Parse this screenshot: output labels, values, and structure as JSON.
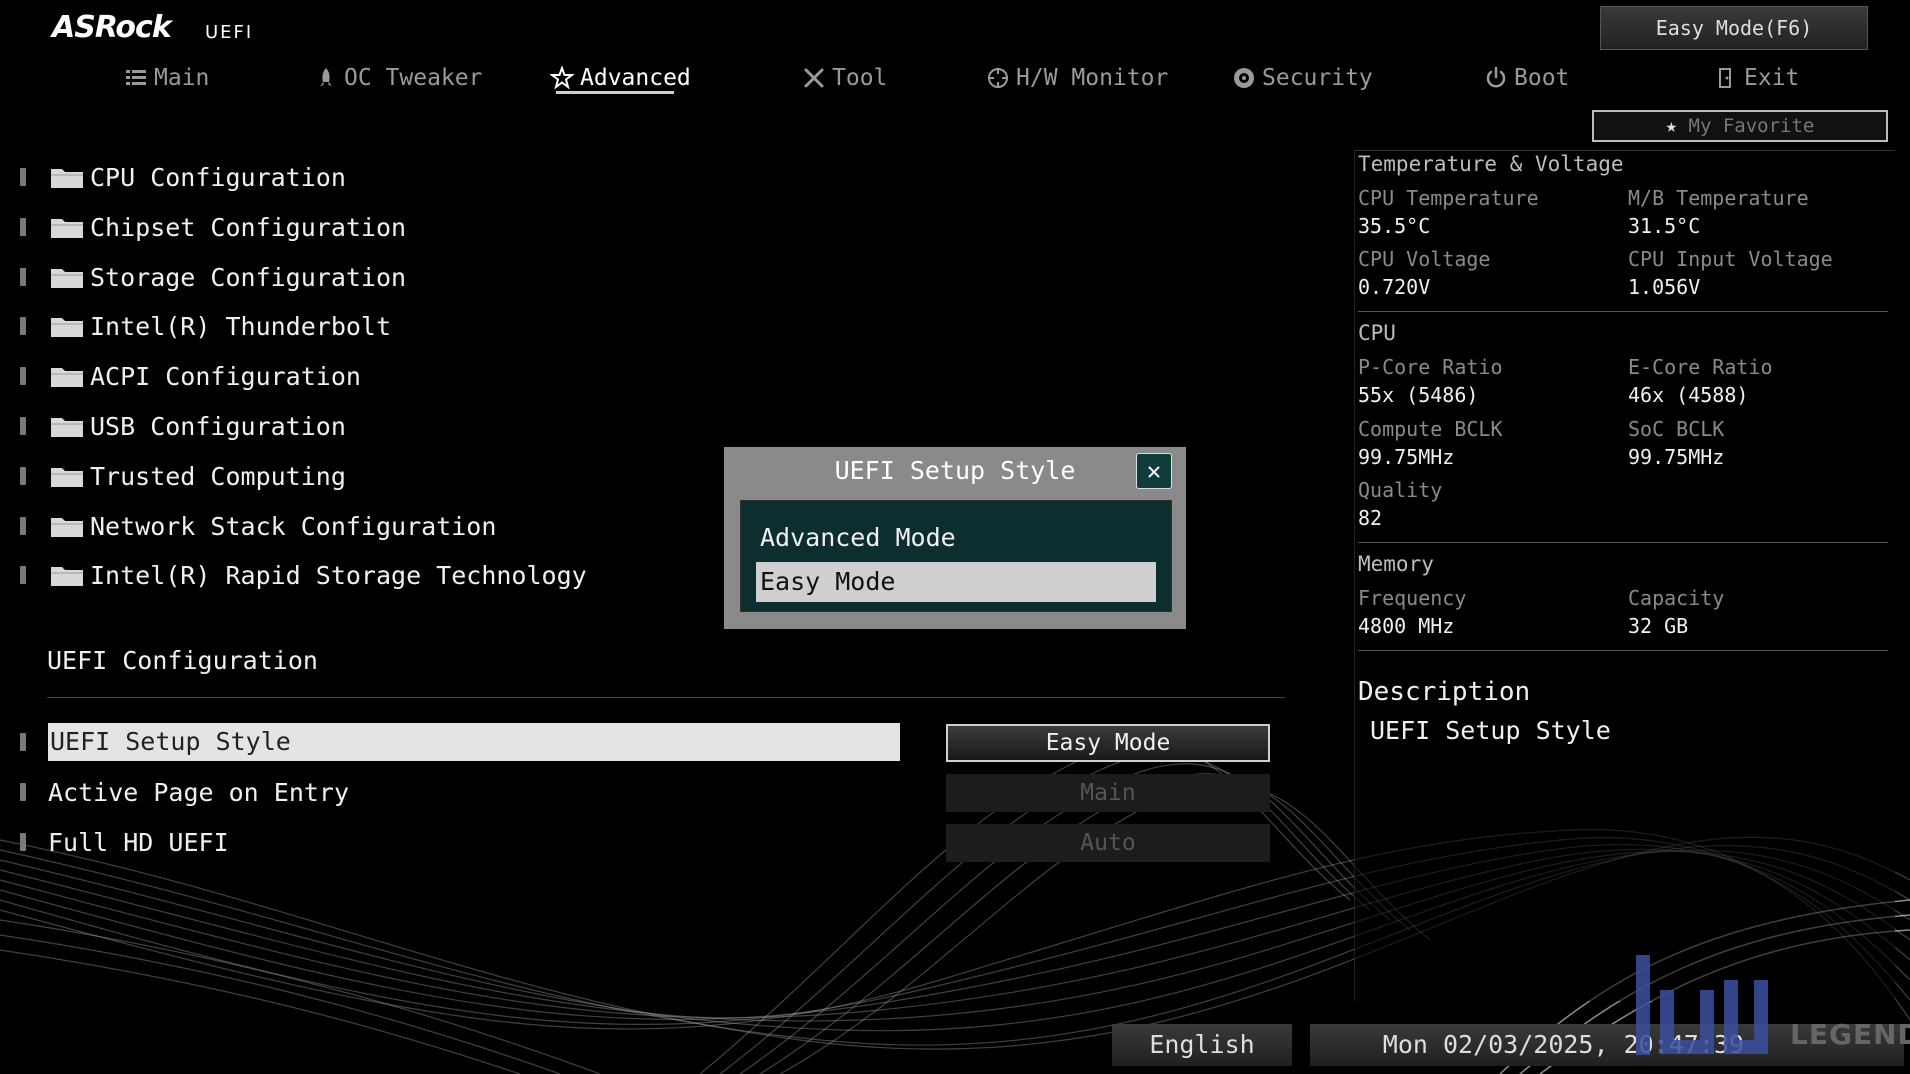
{
  "header": {
    "brand": "ASRock",
    "brand_suffix": "UEFI",
    "easy_mode_button": "Easy Mode(F6)",
    "my_favorite": "My Favorite"
  },
  "nav": {
    "tabs": [
      {
        "label": "Main",
        "icon": "list-icon"
      },
      {
        "label": "OC Tweaker",
        "icon": "rocket-icon"
      },
      {
        "label": "Advanced",
        "icon": "star-icon",
        "active": true
      },
      {
        "label": "Tool",
        "icon": "tools-icon"
      },
      {
        "label": "H/W Monitor",
        "icon": "crosshair-icon"
      },
      {
        "label": "Security",
        "icon": "shield-icon"
      },
      {
        "label": "Boot",
        "icon": "power-icon"
      },
      {
        "label": "Exit",
        "icon": "exit-icon"
      }
    ]
  },
  "menu": {
    "items": [
      "CPU Configuration",
      "Chipset Configuration",
      "Storage Configuration",
      "Intel(R) Thunderbolt",
      "ACPI Configuration",
      "USB Configuration",
      "Trusted Computing",
      "Network Stack Configuration",
      "Intel(R) Rapid Storage Technology"
    ]
  },
  "uefi_config": {
    "title": "UEFI Configuration",
    "rows": [
      {
        "label": "UEFI Setup Style",
        "value": "Easy Mode"
      },
      {
        "label": "Active Page on Entry",
        "value": "Main"
      },
      {
        "label": "Full HD UEFI",
        "value": "Auto"
      }
    ]
  },
  "modal": {
    "title": "UEFI Setup Style",
    "options": [
      "Advanced Mode",
      "Easy Mode"
    ],
    "selected": "Easy Mode"
  },
  "panel": {
    "temp_voltage": {
      "title": "Temperature & Voltage",
      "cpu_temp_label": "CPU Temperature",
      "cpu_temp": "35.5°C",
      "mb_temp_label": "M/B Temperature",
      "mb_temp": "31.5°C",
      "cpu_volt_label": "CPU Voltage",
      "cpu_volt": "0.720V",
      "cpu_input_label": "CPU Input Voltage",
      "cpu_input": "1.056V"
    },
    "cpu": {
      "title": "CPU",
      "pcore_label": "P-Core Ratio",
      "pcore": "55x (5486)",
      "ecore_label": "E-Core Ratio",
      "ecore": "46x (4588)",
      "bclk_label": "Compute BCLK",
      "bclk": "99.75MHz",
      "soc_label": "SoC BCLK",
      "soc": "99.75MHz",
      "quality_label": "Quality",
      "quality": "82"
    },
    "memory": {
      "title": "Memory",
      "freq_label": "Frequency",
      "freq": "4800 MHz",
      "cap_label": "Capacity",
      "cap": "32 GB"
    },
    "description": {
      "title": "Description",
      "text": "UEFI Setup Style"
    }
  },
  "footer": {
    "language": "English",
    "datetime": "Mon 02/03/2025, 20:47:39",
    "watermark": "LEGEND"
  }
}
